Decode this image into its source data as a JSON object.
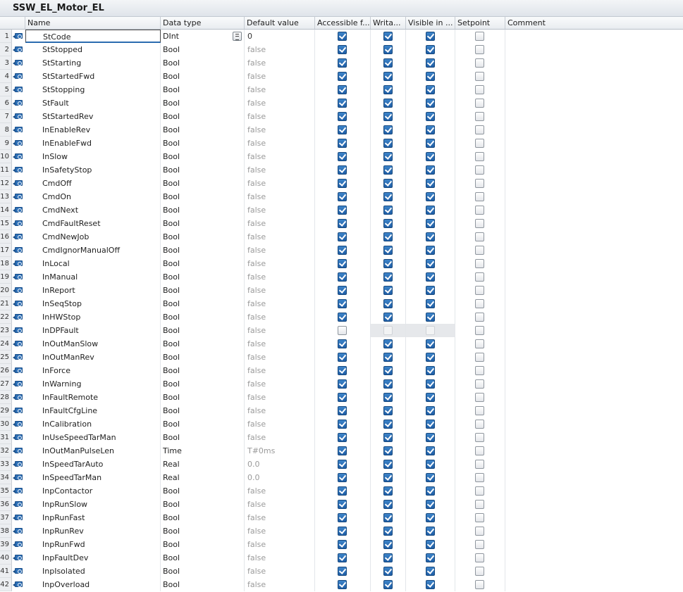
{
  "window": {
    "title": "SSW_EL_Motor_EL"
  },
  "columns": {
    "name": "Name",
    "data_type": "Data type",
    "default_value": "Default value",
    "accessible": "Accessible f...",
    "writable": "Writa...",
    "visible": "Visible in ...",
    "setpoint": "Setpoint",
    "comment": "Comment"
  },
  "icons": {
    "row_type": "interface-input-icon",
    "type_picker": "list-picker-icon"
  },
  "colors": {
    "checkbox_checked": "#2a6ab4",
    "row_header": "#eceef1",
    "title_bar": "#e6eaee"
  },
  "rows": [
    {
      "num": "1",
      "name": "StCode",
      "type": "DInt",
      "default": "0",
      "acc": true,
      "wri": true,
      "vis": true,
      "set": false
    },
    {
      "num": "2",
      "name": "StStopped",
      "type": "Bool",
      "default": "false",
      "acc": true,
      "wri": true,
      "vis": true,
      "set": false
    },
    {
      "num": "3",
      "name": "StStarting",
      "type": "Bool",
      "default": "false",
      "acc": true,
      "wri": true,
      "vis": true,
      "set": false
    },
    {
      "num": "4",
      "name": "StStartedFwd",
      "type": "Bool",
      "default": "false",
      "acc": true,
      "wri": true,
      "vis": true,
      "set": false
    },
    {
      "num": "5",
      "name": "StStopping",
      "type": "Bool",
      "default": "false",
      "acc": true,
      "wri": true,
      "vis": true,
      "set": false
    },
    {
      "num": "6",
      "name": "StFault",
      "type": "Bool",
      "default": "false",
      "acc": true,
      "wri": true,
      "vis": true,
      "set": false
    },
    {
      "num": "7",
      "name": "StStartedRev",
      "type": "Bool",
      "default": "false",
      "acc": true,
      "wri": true,
      "vis": true,
      "set": false
    },
    {
      "num": "8",
      "name": "InEnableRev",
      "type": "Bool",
      "default": "false",
      "acc": true,
      "wri": true,
      "vis": true,
      "set": false
    },
    {
      "num": "9",
      "name": "InEnableFwd",
      "type": "Bool",
      "default": "false",
      "acc": true,
      "wri": true,
      "vis": true,
      "set": false
    },
    {
      "num": "10",
      "name": "InSlow",
      "type": "Bool",
      "default": "false",
      "acc": true,
      "wri": true,
      "vis": true,
      "set": false
    },
    {
      "num": "11",
      "name": "InSafetyStop",
      "type": "Bool",
      "default": "false",
      "acc": true,
      "wri": true,
      "vis": true,
      "set": false
    },
    {
      "num": "12",
      "name": "CmdOff",
      "type": "Bool",
      "default": "false",
      "acc": true,
      "wri": true,
      "vis": true,
      "set": false
    },
    {
      "num": "13",
      "name": "CmdOn",
      "type": "Bool",
      "default": "false",
      "acc": true,
      "wri": true,
      "vis": true,
      "set": false
    },
    {
      "num": "14",
      "name": "CmdNext",
      "type": "Bool",
      "default": "false",
      "acc": true,
      "wri": true,
      "vis": true,
      "set": false
    },
    {
      "num": "15",
      "name": "CmdFaultReset",
      "type": "Bool",
      "default": "false",
      "acc": true,
      "wri": true,
      "vis": true,
      "set": false
    },
    {
      "num": "16",
      "name": "CmdNewJob",
      "type": "Bool",
      "default": "false",
      "acc": true,
      "wri": true,
      "vis": true,
      "set": false
    },
    {
      "num": "17",
      "name": "CmdIgnorManualOff",
      "type": "Bool",
      "default": "false",
      "acc": true,
      "wri": true,
      "vis": true,
      "set": false
    },
    {
      "num": "18",
      "name": "InLocal",
      "type": "Bool",
      "default": "false",
      "acc": true,
      "wri": true,
      "vis": true,
      "set": false
    },
    {
      "num": "19",
      "name": "InManual",
      "type": "Bool",
      "default": "false",
      "acc": true,
      "wri": true,
      "vis": true,
      "set": false
    },
    {
      "num": "20",
      "name": "InReport",
      "type": "Bool",
      "default": "false",
      "acc": true,
      "wri": true,
      "vis": true,
      "set": false
    },
    {
      "num": "21",
      "name": "InSeqStop",
      "type": "Bool",
      "default": "false",
      "acc": true,
      "wri": true,
      "vis": true,
      "set": false
    },
    {
      "num": "22",
      "name": "InHWStop",
      "type": "Bool",
      "default": "false",
      "acc": true,
      "wri": true,
      "vis": true,
      "set": false
    },
    {
      "num": "23",
      "name": "InDPFault",
      "type": "Bool",
      "default": "false",
      "acc": false,
      "wri": false,
      "vis": false,
      "set": false,
      "disabled": true
    },
    {
      "num": "24",
      "name": "InOutManSlow",
      "type": "Bool",
      "default": "false",
      "acc": true,
      "wri": true,
      "vis": true,
      "set": false
    },
    {
      "num": "25",
      "name": "InOutManRev",
      "type": "Bool",
      "default": "false",
      "acc": true,
      "wri": true,
      "vis": true,
      "set": false
    },
    {
      "num": "26",
      "name": "InForce",
      "type": "Bool",
      "default": "false",
      "acc": true,
      "wri": true,
      "vis": true,
      "set": false
    },
    {
      "num": "27",
      "name": "InWarning",
      "type": "Bool",
      "default": "false",
      "acc": true,
      "wri": true,
      "vis": true,
      "set": false
    },
    {
      "num": "28",
      "name": "InFaultRemote",
      "type": "Bool",
      "default": "false",
      "acc": true,
      "wri": true,
      "vis": true,
      "set": false
    },
    {
      "num": "29",
      "name": "InFaultCfgLine",
      "type": "Bool",
      "default": "false",
      "acc": true,
      "wri": true,
      "vis": true,
      "set": false
    },
    {
      "num": "30",
      "name": "InCalibration",
      "type": "Bool",
      "default": "false",
      "acc": true,
      "wri": true,
      "vis": true,
      "set": false
    },
    {
      "num": "31",
      "name": "InUseSpeedTarMan",
      "type": "Bool",
      "default": "false",
      "acc": true,
      "wri": true,
      "vis": true,
      "set": false
    },
    {
      "num": "32",
      "name": "InOutManPulseLen",
      "type": "Time",
      "default": "T#0ms",
      "acc": true,
      "wri": true,
      "vis": true,
      "set": false
    },
    {
      "num": "33",
      "name": "InSpeedTarAuto",
      "type": "Real",
      "default": "0.0",
      "acc": true,
      "wri": true,
      "vis": true,
      "set": false
    },
    {
      "num": "34",
      "name": "InSpeedTarMan",
      "type": "Real",
      "default": "0.0",
      "acc": true,
      "wri": true,
      "vis": true,
      "set": false
    },
    {
      "num": "35",
      "name": "InpContactor",
      "type": "Bool",
      "default": "false",
      "acc": true,
      "wri": true,
      "vis": true,
      "set": false
    },
    {
      "num": "36",
      "name": "InpRunSlow",
      "type": "Bool",
      "default": "false",
      "acc": true,
      "wri": true,
      "vis": true,
      "set": false
    },
    {
      "num": "37",
      "name": "InpRunFast",
      "type": "Bool",
      "default": "false",
      "acc": true,
      "wri": true,
      "vis": true,
      "set": false
    },
    {
      "num": "38",
      "name": "InpRunRev",
      "type": "Bool",
      "default": "false",
      "acc": true,
      "wri": true,
      "vis": true,
      "set": false
    },
    {
      "num": "39",
      "name": "InpRunFwd",
      "type": "Bool",
      "default": "false",
      "acc": true,
      "wri": true,
      "vis": true,
      "set": false
    },
    {
      "num": "40",
      "name": "InpFaultDev",
      "type": "Bool",
      "default": "false",
      "acc": true,
      "wri": true,
      "vis": true,
      "set": false
    },
    {
      "num": "41",
      "name": "InpIsolated",
      "type": "Bool",
      "default": "false",
      "acc": true,
      "wri": true,
      "vis": true,
      "set": false
    },
    {
      "num": "42",
      "name": "InpOverload",
      "type": "Bool",
      "default": "false",
      "acc": true,
      "wri": true,
      "vis": true,
      "set": false
    }
  ]
}
